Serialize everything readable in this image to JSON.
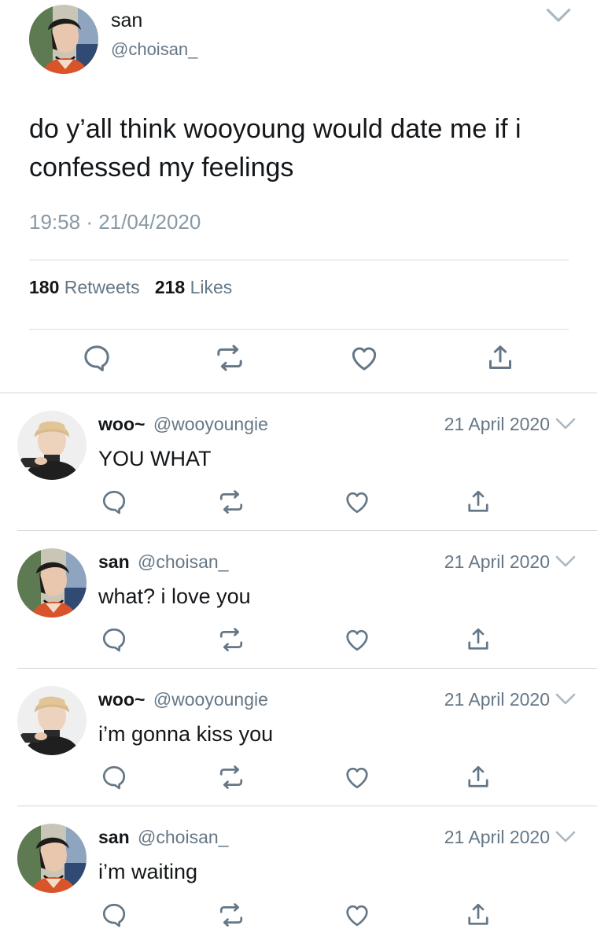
{
  "main_tweet": {
    "name": "san",
    "handle": "@choisan_",
    "text": "do y’all think wooyoung would date me if i confessed my feelings",
    "time": "19:58",
    "separator": "·",
    "date": "21/04/2020",
    "retweets_count": "180",
    "retweets_label": "Retweets",
    "likes_count": "218",
    "likes_label": "Likes"
  },
  "replies": [
    {
      "name": "woo~",
      "handle": "@wooyoungie",
      "date": "21 April 2020",
      "text": "YOU WHAT",
      "avatar": "wooyoung"
    },
    {
      "name": "san",
      "handle": "@choisan_",
      "date": "21 April 2020",
      "text": "what? i love you",
      "avatar": "san"
    },
    {
      "name": "woo~",
      "handle": "@wooyoungie",
      "date": "21 April 2020",
      "text": "i’m gonna kiss you",
      "avatar": "wooyoung"
    },
    {
      "name": "san",
      "handle": "@choisan_",
      "date": "21 April 2020",
      "text": "i’m waiting",
      "avatar": "san"
    }
  ],
  "icons": [
    "reply-icon",
    "retweet-icon",
    "like-icon",
    "share-icon",
    "chevron-down-icon"
  ],
  "colors": {
    "text": "#14171a",
    "secondary": "#657786",
    "meta": "#8899a6",
    "divider": "#d8dde1"
  }
}
